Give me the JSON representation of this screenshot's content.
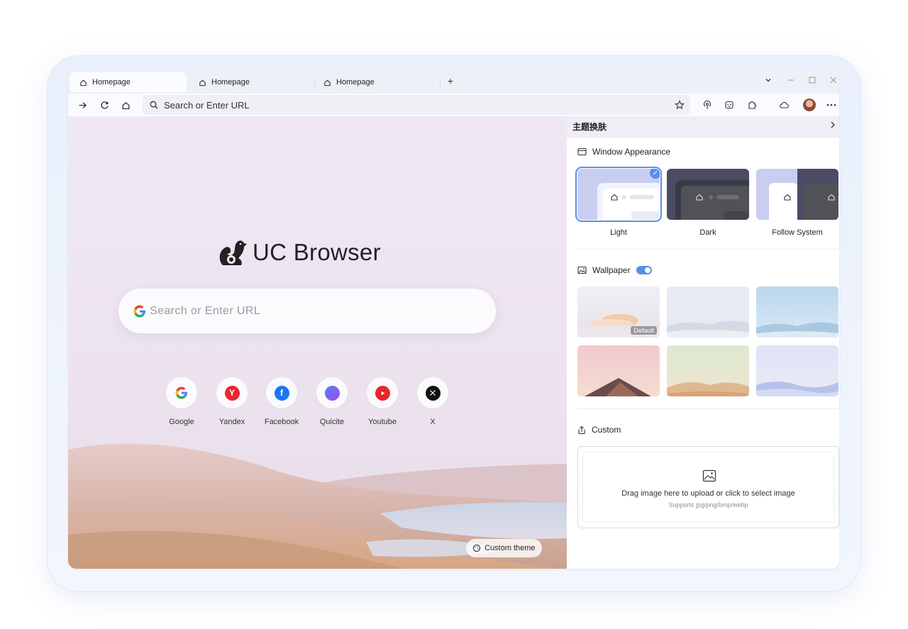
{
  "tabs": [
    {
      "label": "Homepage",
      "active": true
    },
    {
      "label": "Homepage",
      "active": false
    },
    {
      "label": "Homepage",
      "active": false
    }
  ],
  "tabbar": {
    "new_tab": "+"
  },
  "toolbar": {
    "url_placeholder": "Search or Enter URL"
  },
  "newtab": {
    "logo_text": "UC Browser",
    "search_placeholder": "Search or Enter URL",
    "shortcuts": [
      {
        "label": "Google",
        "color": "#4285f4"
      },
      {
        "label": "Yandex",
        "color": "#e8262e"
      },
      {
        "label": "Facebook",
        "color": "#1877f2"
      },
      {
        "label": "Quicite",
        "color": "#7c5cf0"
      },
      {
        "label": "Youtube",
        "color": "#e8262e"
      },
      {
        "label": "X",
        "color": "#111111"
      }
    ],
    "custom_theme_label": "Custom theme"
  },
  "panel": {
    "title": "主题换肤",
    "window_appearance": {
      "title": "Window Appearance",
      "options": [
        {
          "label": "Light",
          "selected": true
        },
        {
          "label": "Dark",
          "selected": false
        },
        {
          "label": "Follow System",
          "selected": false
        }
      ]
    },
    "wallpaper": {
      "title": "Wallpaper",
      "enabled": true,
      "default_badge": "Default",
      "count": 6
    },
    "custom": {
      "title": "Custom",
      "drop_text": "Drag image here to upload or click to select image",
      "supports_text": "Supports jpg/png/bmp/webp"
    }
  },
  "colors": {
    "accent": "#5b8fe8"
  }
}
